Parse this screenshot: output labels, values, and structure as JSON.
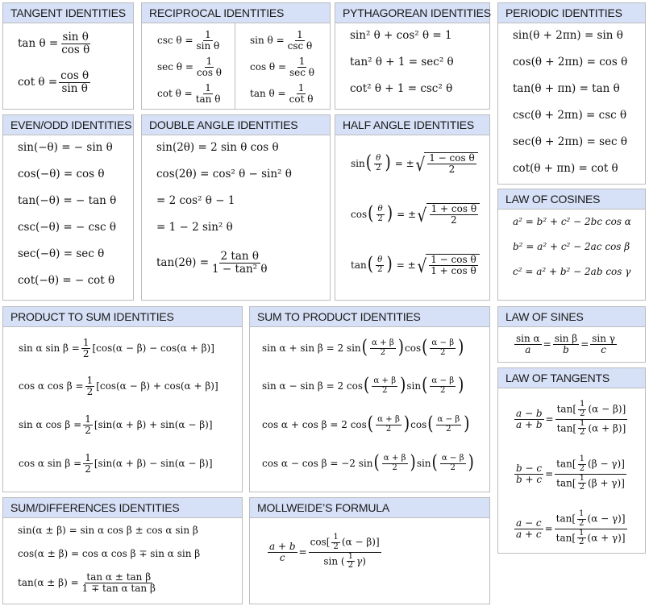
{
  "colors": {
    "header_bg": "#d6e0f6",
    "border": "#bdbdbd",
    "text": "#111111"
  },
  "panels": {
    "tangent": {
      "title": "TANGENT IDENTITIES",
      "eqs": [
        {
          "lhs": "tan θ =",
          "num": "sin θ",
          "den": "cos θ"
        },
        {
          "lhs": "cot θ =",
          "num": "cos θ",
          "den": "sin θ"
        }
      ]
    },
    "reciprocal": {
      "title": "RECIPROCAL IDENTITIES",
      "left": [
        {
          "lhs": "csc θ =",
          "num": "1",
          "den": "sin θ"
        },
        {
          "lhs": "sec θ =",
          "num": "1",
          "den": "cos θ"
        },
        {
          "lhs": "cot θ =",
          "num": "1",
          "den": "tan θ"
        }
      ],
      "right": [
        {
          "lhs": "sin θ =",
          "num": "1",
          "den": "csc θ"
        },
        {
          "lhs": "cos θ =",
          "num": "1",
          "den": "sec θ"
        },
        {
          "lhs": "tan θ =",
          "num": "1",
          "den": "cot θ"
        }
      ]
    },
    "pythagorean": {
      "title": "PYTHAGOREAN IDENTITIES",
      "eqs": [
        "sin² θ + cos² θ = 1",
        "tan² θ + 1 = sec² θ",
        "cot² θ + 1 = csc² θ"
      ]
    },
    "periodic": {
      "title": "PERIODIC IDENTITIES",
      "eqs": [
        "sin(θ + 2πn) = sin θ",
        "cos(θ + 2πn) = cos θ",
        "tan(θ + πn) = tan θ",
        "csc(θ + 2πn) = csc θ",
        "sec(θ + 2πn) = sec θ",
        "cot(θ + πn) = cot θ"
      ]
    },
    "even_odd": {
      "title": "EVEN/ODD IDENTITIES",
      "eqs": [
        "sin(−θ) = − sin θ",
        "cos(−θ) = cos θ",
        "tan(−θ) = − tan θ",
        "csc(−θ) = − csc θ",
        "sec(−θ) = sec θ",
        "cot(−θ) = − cot θ"
      ]
    },
    "double_angle": {
      "title": "DOUBLE ANGLE IDENTITIES",
      "eqs": [
        "sin(2θ) = 2 sin θ cos θ",
        "cos(2θ) = cos² θ − sin² θ",
        "= 2 cos² θ − 1",
        "= 1 − 2 sin² θ"
      ],
      "tan": {
        "lhs": "tan(2θ) =",
        "num": "2 tan θ",
        "den": "1 − tan² θ"
      }
    },
    "half_angle": {
      "title": "HALF ANGLE IDENTITIES",
      "eqs": [
        {
          "fn": "sin",
          "arg_num": "θ",
          "arg_den": "2",
          "sign": "= ±",
          "num": "1 − cos θ",
          "den": "2"
        },
        {
          "fn": "cos",
          "arg_num": "θ",
          "arg_den": "2",
          "sign": "= ±",
          "num": "1 + cos θ",
          "den": "2"
        },
        {
          "fn": "tan",
          "arg_num": "θ",
          "arg_den": "2",
          "sign": "= ±",
          "num": "1 − cos θ",
          "den": "1 + cos θ"
        }
      ]
    },
    "law_cosines": {
      "title": "LAW OF COSINES",
      "eqs": [
        "a² = b² + c² − 2bc cos α",
        "b² = a² + c² − 2ac cos β",
        "c² = a² + b² − 2ab cos γ"
      ]
    },
    "product_to_sum": {
      "title": "PRODUCT TO SUM IDENTITIES",
      "eqs": [
        {
          "lhs": "sin α sin β =",
          "half_num": "1",
          "half_den": "2",
          "rhs": "[cos(α − β) − cos(α + β)]"
        },
        {
          "lhs": "cos α cos β =",
          "half_num": "1",
          "half_den": "2",
          "rhs": "[cos(α − β) + cos(α + β)]"
        },
        {
          "lhs": "sin α cos β =",
          "half_num": "1",
          "half_den": "2",
          "rhs": "[sin(α + β) + sin(α − β)]"
        },
        {
          "lhs": "cos α sin β =",
          "half_num": "1",
          "half_den": "2",
          "rhs": "[sin(α + β) − sin(α − β)]"
        }
      ]
    },
    "sum_to_product": {
      "title": "SUM TO PRODUCT IDENTITIES",
      "eqs": [
        {
          "lhs": "sin α + sin β = 2 sin",
          "a_num": "α + β",
          "a_den": "2",
          "mid": "cos",
          "b_num": "α − β",
          "b_den": "2"
        },
        {
          "lhs": "sin α − sin β = 2 cos",
          "a_num": "α + β",
          "a_den": "2",
          "mid": "sin",
          "b_num": "α − β",
          "b_den": "2"
        },
        {
          "lhs": "cos α + cos β = 2 cos",
          "a_num": "α + β",
          "a_den": "2",
          "mid": "cos",
          "b_num": "α − β",
          "b_den": "2"
        },
        {
          "lhs": "cos α − cos β = −2 sin",
          "a_num": "α + β",
          "a_den": "2",
          "mid": "sin",
          "b_num": "α − β",
          "b_den": "2"
        }
      ]
    },
    "law_sines": {
      "title": "LAW OF SINES",
      "terms": [
        {
          "num": "sin α",
          "den": "a"
        },
        {
          "num": "sin β",
          "den": "b"
        },
        {
          "num": "sin γ",
          "den": "c"
        }
      ],
      "eq_sign": "="
    },
    "law_tangents": {
      "title": "LAW OF TANGENTS",
      "eqs": [
        {
          "l_num": "a − b",
          "l_den": "a + b",
          "top": "(α − β)",
          "bot": "(α + β)"
        },
        {
          "l_num": "b − c",
          "l_den": "b + c",
          "top": "(β − γ)",
          "bot": "(β + γ)"
        },
        {
          "l_num": "a − c",
          "l_den": "a + c",
          "top": "(α − γ)",
          "bot": "(α + γ)"
        }
      ],
      "fn": "tan",
      "half_num": "1",
      "half_den": "2"
    },
    "sum_differences": {
      "title": "SUM/DIFFERENCES IDENTITIES",
      "eqs": [
        "sin(α ± β) = sin α cos β ± cos α sin β",
        "cos(α ± β) = cos α cos β ∓ sin α sin β"
      ],
      "tan": {
        "lhs": "tan(α ± β) =",
        "num": "tan α ± tan β",
        "den": "1 ∓ tan α tan β"
      }
    },
    "mollweide": {
      "title": "MOLLWEIDE’S FORMULA",
      "l_num": "a + b",
      "l_den": "c",
      "top_fn": "cos",
      "top_arg": "(α − β)",
      "bot_fn": "sin",
      "bot_arg": "γ",
      "half_num": "1",
      "half_den": "2"
    }
  }
}
